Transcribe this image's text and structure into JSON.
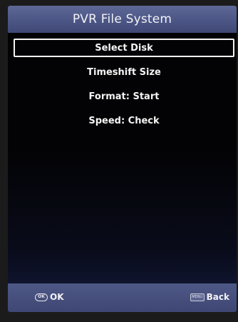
{
  "header": {
    "title": "PVR File System"
  },
  "menu": {
    "items": [
      {
        "label": "Select Disk"
      },
      {
        "label": "Timeshift Size"
      },
      {
        "label": "Format: Start"
      },
      {
        "label": "Speed: Check"
      }
    ]
  },
  "footer": {
    "ok_icon_text": "OK",
    "ok_label": "OK",
    "menu_icon_text": "MENU",
    "back_label": "Back"
  },
  "colors": {
    "title_bar": "#4c5686",
    "footer_bar": "#4e5886",
    "background": "#030305",
    "text": "#f4f4f4"
  },
  "icons": {
    "ok_button": "ok-button-icon",
    "menu_button": "menu-button-icon"
  }
}
